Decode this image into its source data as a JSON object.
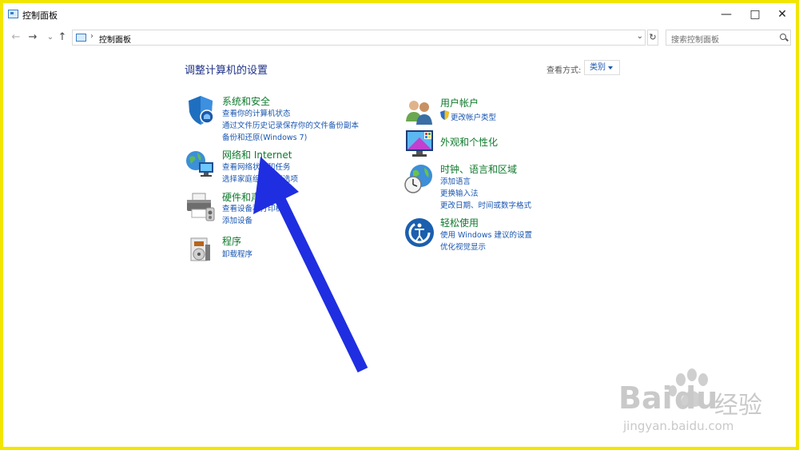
{
  "window": {
    "title": "控制面板",
    "minimize": "—",
    "maximize": "□",
    "close": "✕"
  },
  "address_bar": {
    "back": "←",
    "forward": "→",
    "recent": "⌄",
    "up": "↑",
    "separator": "›",
    "path": "控制面板",
    "dropdown": "⌄",
    "refresh": "↻",
    "search_placeholder": "搜索控制面板"
  },
  "content": {
    "heading": "调整计算机的设置",
    "view_by_label": "查看方式:",
    "view_by_value": "类别"
  },
  "categories_left": [
    {
      "icon": "shield-icon",
      "title": "系统和安全",
      "links": [
        "查看你的计算机状态",
        "通过文件历史记录保存你的文件备份副本",
        "备份和还原(Windows 7)"
      ]
    },
    {
      "icon": "network-globe-icon",
      "title": "网络和 Internet",
      "links": [
        "查看网络状态和任务",
        "选择家庭组和共享选项"
      ]
    },
    {
      "icon": "printer-icon",
      "title": "硬件和声音",
      "links": [
        "查看设备和打印机",
        "添加设备"
      ]
    },
    {
      "icon": "programs-icon",
      "title": "程序",
      "links": [
        "卸载程序"
      ]
    }
  ],
  "categories_right": [
    {
      "icon": "users-icon",
      "title": "用户帐户",
      "links": [
        "更改帐户类型"
      ]
    },
    {
      "icon": "appearance-icon",
      "title": "外观和个性化",
      "links": []
    },
    {
      "icon": "clock-globe-icon",
      "title": "时钟、语言和区域",
      "links": [
        "添加语言",
        "更换输入法",
        "更改日期、时间或数字格式"
      ]
    },
    {
      "icon": "ease-of-access-icon",
      "title": "轻松使用",
      "links": [
        "使用 Windows 建议的设置",
        "优化视觉显示"
      ]
    }
  ],
  "watermark": {
    "brand": "Bai",
    "brand2": "du",
    "brand_cn": "经验",
    "url": "jingyan.baidu.com"
  },
  "colors": {
    "frame_border": "#f2e600",
    "outer_border": "#1b2bd6",
    "category_title": "#0e7a2c",
    "link": "#1a56b0",
    "arrow": "#1f2ee0"
  }
}
